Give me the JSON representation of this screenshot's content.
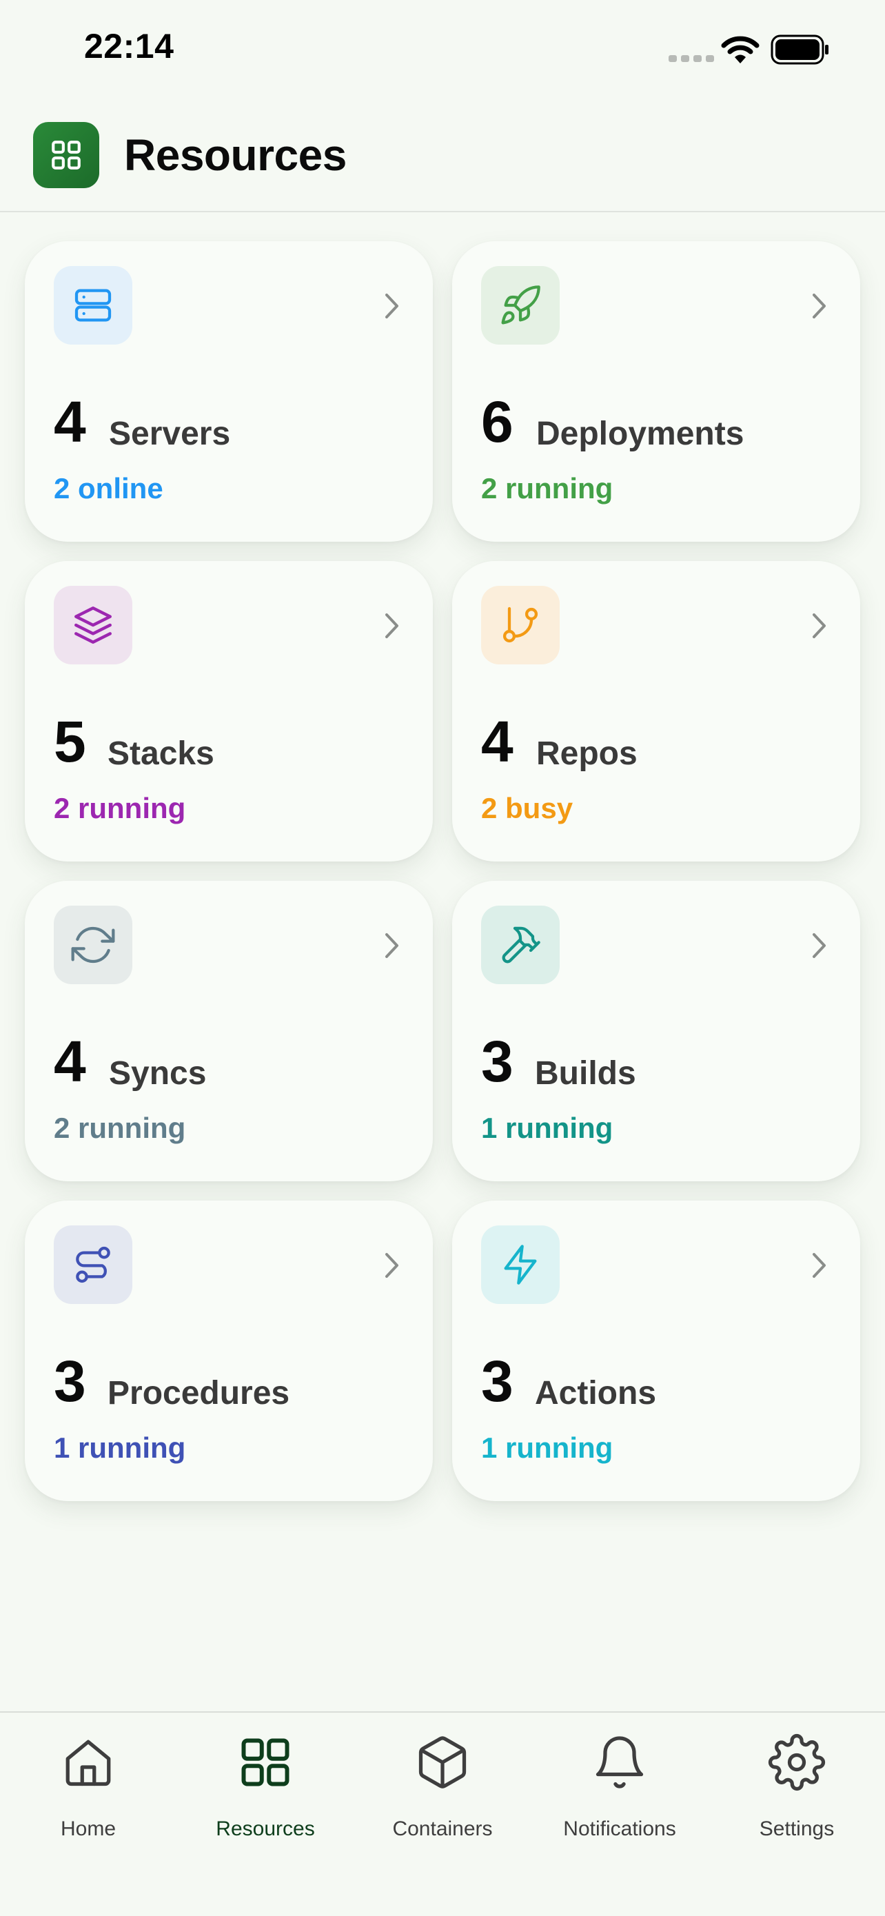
{
  "status_bar": {
    "time": "22:14"
  },
  "header": {
    "title": "Resources"
  },
  "cards": [
    {
      "count": "4",
      "label": "Servers",
      "status": "2 online",
      "icon": "server-icon",
      "color": "#2196f3",
      "tint": "#e3f0fa"
    },
    {
      "count": "6",
      "label": "Deployments",
      "status": "2 running",
      "icon": "rocket-icon",
      "color": "#43a047",
      "tint": "#e5f1e4"
    },
    {
      "count": "5",
      "label": "Stacks",
      "status": "2 running",
      "icon": "layers-icon",
      "color": "#9c27b0",
      "tint": "#efe3ef"
    },
    {
      "count": "4",
      "label": "Repos",
      "status": "2 busy",
      "icon": "git-branch-icon",
      "color": "#f39a14",
      "tint": "#fbeedb"
    },
    {
      "count": "4",
      "label": "Syncs",
      "status": "2 running",
      "icon": "refresh-icon",
      "color": "#607d8b",
      "tint": "#e6ebea"
    },
    {
      "count": "3",
      "label": "Builds",
      "status": "1 running",
      "icon": "hammer-icon",
      "color": "#139488",
      "tint": "#dcefe9"
    },
    {
      "count": "3",
      "label": "Procedures",
      "status": "1 running",
      "icon": "route-icon",
      "color": "#3f51b5",
      "tint": "#e4e8f1"
    },
    {
      "count": "3",
      "label": "Actions",
      "status": "1 running",
      "icon": "lightning-icon",
      "color": "#16b4cc",
      "tint": "#ddf3f3"
    }
  ],
  "tab_bar": {
    "items": [
      {
        "label": "Home",
        "icon": "home-icon",
        "active": false
      },
      {
        "label": "Resources",
        "icon": "grid-icon",
        "active": true
      },
      {
        "label": "Containers",
        "icon": "box-icon",
        "active": false
      },
      {
        "label": "Notifications",
        "icon": "bell-icon",
        "active": false
      },
      {
        "label": "Settings",
        "icon": "gear-icon",
        "active": false
      }
    ]
  },
  "colors": {
    "accent": "#1e7a2e",
    "active_tab": "#0e3e1c",
    "chevron": "#8a8d8a"
  }
}
